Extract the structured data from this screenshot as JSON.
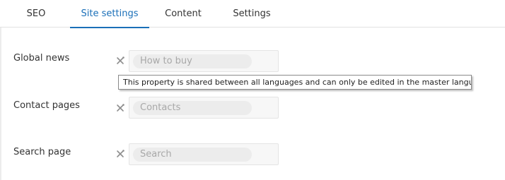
{
  "tabs": [
    {
      "label": "SEO",
      "active": false
    },
    {
      "label": "Site settings",
      "active": true
    },
    {
      "label": "Content",
      "active": false
    },
    {
      "label": "Settings",
      "active": false
    }
  ],
  "fields": [
    {
      "label": "Global news",
      "value": "How to buy",
      "icon": "shared-property-icon"
    },
    {
      "label": "Contact pages",
      "value": "Contacts",
      "icon": "shared-property-icon"
    },
    {
      "label": "Search page",
      "value": "Search",
      "icon": "shared-property-icon"
    }
  ],
  "tooltip": {
    "text": "This property is shared between all languages and can only be edited in the master language"
  },
  "colors": {
    "accent": "#1a6fb8",
    "field_bg": "#f7f7f7",
    "pill_bg": "#ececec",
    "placeholder_text": "#a8a8a8"
  }
}
